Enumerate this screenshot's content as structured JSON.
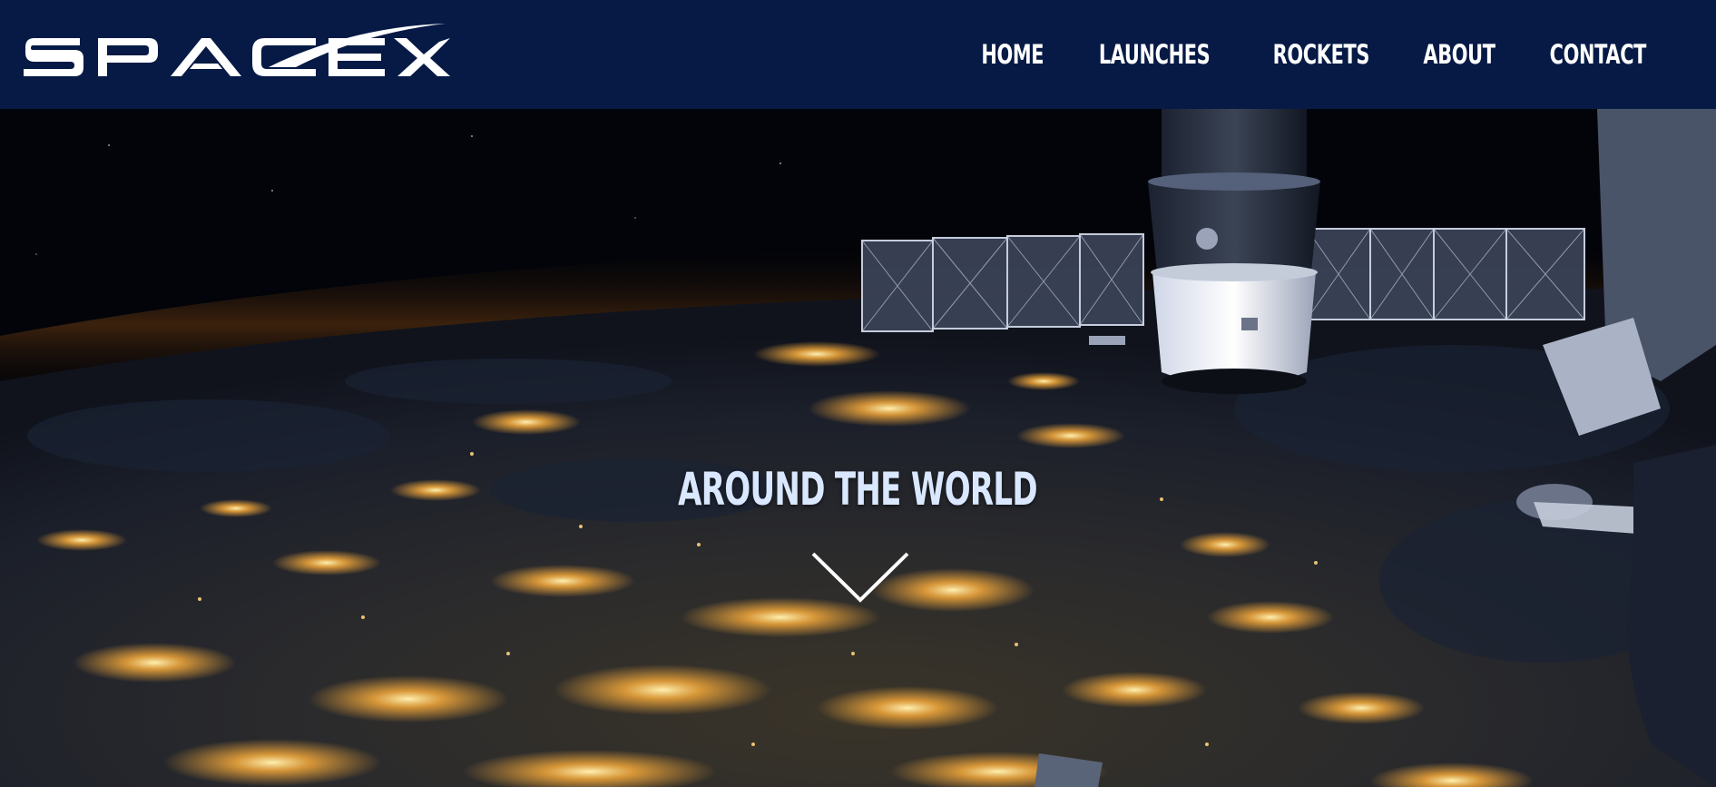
{
  "brand": {
    "logo_text": "SPACEX"
  },
  "nav": {
    "items": [
      {
        "label": "HOME"
      },
      {
        "label": "LAUNCHES"
      },
      {
        "label": "ROCKETS"
      },
      {
        "label": "ABOUT"
      },
      {
        "label": "CONTACT"
      }
    ]
  },
  "hero": {
    "title": "AROUND THE WORLD",
    "scroll_icon": "chevron-down-icon"
  },
  "colors": {
    "navbar_bg": "#061a45",
    "text": "#ffffff",
    "hero_title": "#d9e8ff",
    "city_lights": "#f3a83a"
  }
}
